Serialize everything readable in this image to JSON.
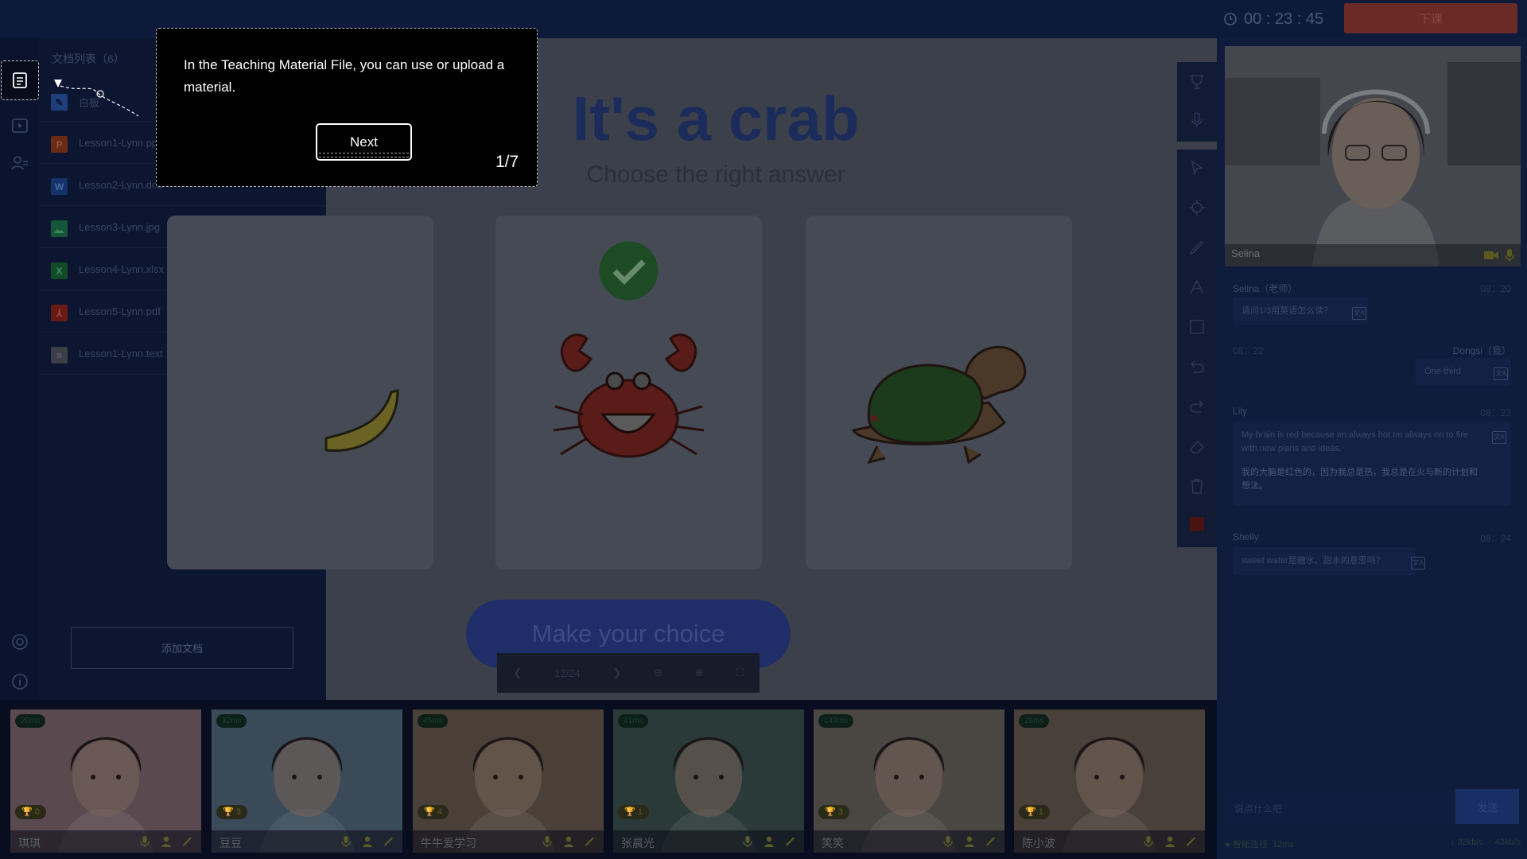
{
  "topbar": {
    "timer": "00 : 23 : 45",
    "end_class_label": "下课"
  },
  "docpanel": {
    "title": "文档列表（6）",
    "files": [
      {
        "name": "白板",
        "type": "whiteboard",
        "color": "#2e5db8"
      },
      {
        "name": "Lesson1-Lynn.ppt",
        "type": "ppt",
        "color": "#a8421f",
        "letter": "P"
      },
      {
        "name": "Lesson2-Lynn.doc",
        "type": "doc",
        "color": "#1f4fa0",
        "letter": "W"
      },
      {
        "name": "Lesson3-Lynn.jpg",
        "type": "image",
        "color": "#1f8a5a"
      },
      {
        "name": "Lesson4-Lynn.xlsx",
        "type": "excel",
        "color": "#1d7a3f",
        "letter": "X"
      },
      {
        "name": "Lesson5-Lynn.pdf",
        "type": "pdf",
        "color": "#b22a22"
      },
      {
        "name": "Lesson1-Lynn.text",
        "type": "text",
        "color": "#6a6f7a"
      }
    ],
    "add_label": "添加文档"
  },
  "slide": {
    "title": "It's a crab",
    "subtitle": "Choose the right answer",
    "choice_label": "Make your choice",
    "page": "12/24"
  },
  "teacher_video": {
    "name": "Selina"
  },
  "chat": [
    {
      "name": "Selina（老师）",
      "time": "08：20",
      "text": "请问1/3用英语怎么读？"
    },
    {
      "name": "Dongsi（我）",
      "time": "08：22",
      "text": "One-third"
    },
    {
      "name": "Lily",
      "time": "08：23",
      "text": "My brain is red because Im always hot.Im always on to fire with new plans and ideas.",
      "translation": "我的大脑是红色的，因为我总是热，我总是在火与新的计划和想法。"
    },
    {
      "name": "Shelly",
      "time": "08：24",
      "text": "sweet water是糖水、甜水的意思吗？"
    }
  ],
  "chat_input": {
    "placeholder": "说点什么吧",
    "send_label": "发送"
  },
  "network": {
    "status": "智能连线",
    "latency": "12ms",
    "down": "32kb/s",
    "up": "43kb/s"
  },
  "students": [
    {
      "name": "琪琪",
      "latency": "20ms",
      "trophies": "0",
      "bg": "#5a4a50"
    },
    {
      "name": "豆豆",
      "latency": "32ms",
      "trophies": "3",
      "bg": "#3a4a58"
    },
    {
      "name": "牛牛爱学习",
      "latency": "45ms",
      "trophies": "4",
      "bg": "#4a4038"
    },
    {
      "name": "张晨光",
      "latency": "41ms",
      "trophies": "1",
      "bg": "#2a3a38"
    },
    {
      "name": "笑笑",
      "latency": "149ms",
      "trophies": "3",
      "bg": "#4a4642"
    },
    {
      "name": "陈小波",
      "latency": "28ms",
      "trophies": "1",
      "bg": "#4a403a"
    }
  ],
  "guide": {
    "text": "In the Teaching Material File, you can use or upload a material.",
    "next_label": "Next",
    "step": "1/7"
  },
  "colors": {
    "accent": "#1f2d68",
    "end_button": "#c0392b",
    "online": "#2ecc71"
  }
}
